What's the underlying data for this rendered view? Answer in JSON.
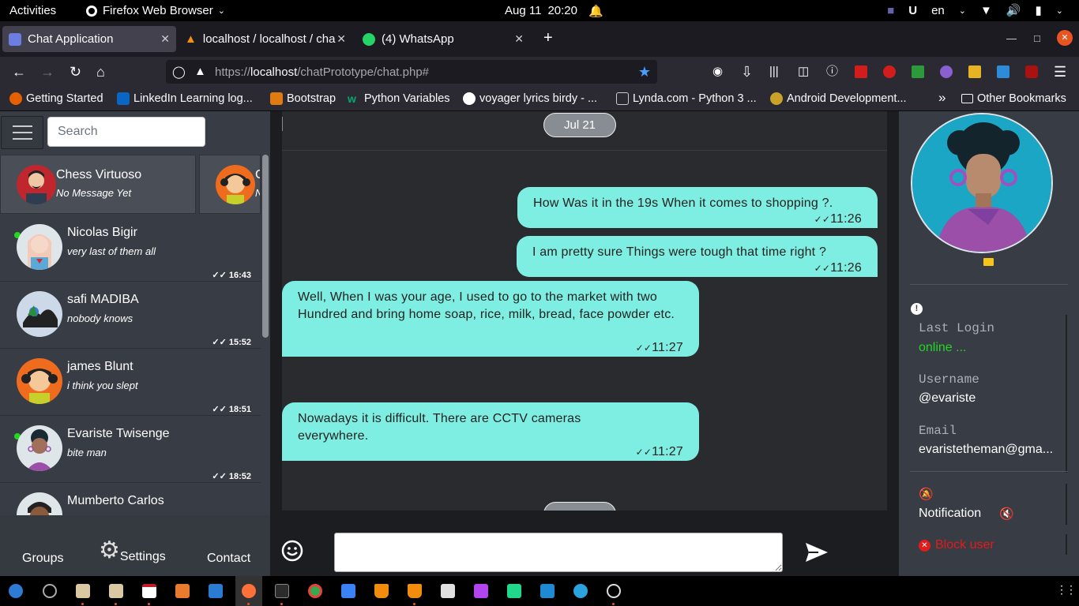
{
  "system": {
    "activities": "Activities",
    "app_name": "Firefox Web Browser",
    "date": "Aug 11",
    "time": "20:20",
    "language": "en"
  },
  "browser": {
    "tabs": [
      {
        "label": "Chat Application"
      },
      {
        "label": "localhost / localhost / cha"
      },
      {
        "label": "(4) WhatsApp"
      }
    ],
    "url_prefix": "https://",
    "url_host": "localhost",
    "url_path": "/chatPrototype/chat.php#",
    "bookmarks": [
      {
        "label": "Getting Started"
      },
      {
        "label": "LinkedIn Learning log..."
      },
      {
        "label": "Bootstrap"
      },
      {
        "label": "Python Variables"
      },
      {
        "label": "voyager lyrics birdy - ..."
      },
      {
        "label": "Lynda.com - Python 3 ..."
      },
      {
        "label": "Android Development..."
      }
    ],
    "other_bookmarks": "Other Bookmarks",
    "overflow": "»"
  },
  "sidebar": {
    "search_placeholder": "Search",
    "favorites": [
      {
        "name": "Chess Virtuoso",
        "message": "No Message Yet"
      },
      {
        "name": "C",
        "message": "N"
      }
    ],
    "chats": [
      {
        "name": "Nicolas Bigir",
        "message": "very last of them all",
        "time": "16:43",
        "online": true
      },
      {
        "name": "safi MADIBA",
        "message": "nobody knows",
        "time": "15:52",
        "online": false
      },
      {
        "name": "james Blunt",
        "message": "i think you slept",
        "time": "18:51",
        "online": false
      },
      {
        "name": "Evariste Twisenge",
        "message": "bite man",
        "time": "18:52",
        "online": true
      },
      {
        "name": "Mumberto Carlos",
        "message": "",
        "time": "",
        "online": false
      }
    ],
    "nav": {
      "groups": "Groups",
      "settings": "Settings",
      "contact": "Contact"
    }
  },
  "conversation": {
    "date_label": "Jul 21",
    "messages": [
      {
        "direction": "sent",
        "text": "How Was it in the 19s When it comes to shopping ?.",
        "time": "11:26"
      },
      {
        "direction": "sent",
        "text": "I am pretty sure Things were tough that time right ?",
        "time": "11:26"
      },
      {
        "direction": "received",
        "text": "Well, When I was your age, I used to go to the market with two Hundred and bring home soap, rice, milk, bread, face powder etc.",
        "time": "11:27"
      },
      {
        "direction": "received",
        "text": "Nowadays it is difficult. There are CCTV cameras everywhere.",
        "time": "11:27"
      }
    ],
    "input_value": ""
  },
  "profile": {
    "last_login_label": "Last Login",
    "last_login_value": "online ...",
    "username_label": "Username",
    "username_value": "@evariste",
    "email_label": "Email",
    "email_value": "evaristetheman@gma...",
    "notification_label": "Notification",
    "block_label": "Block user"
  },
  "colors": {
    "bubble": "#7eeee2",
    "online": "#22d81f",
    "block": "#e31b1b",
    "panel": "#383c44"
  }
}
